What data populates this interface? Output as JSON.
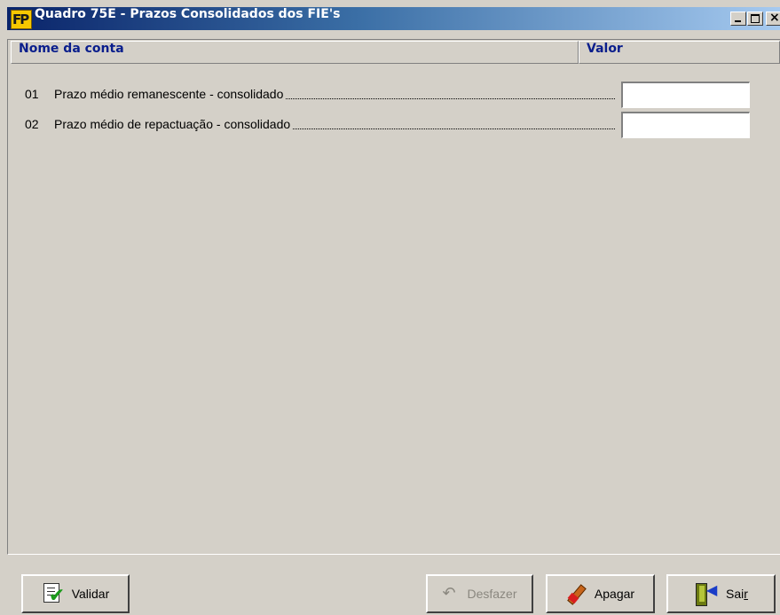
{
  "window": {
    "title": "Quadro 75E - Prazos Consolidados dos FIE's",
    "icon": "fp-app-icon",
    "controls": {
      "minimize": "minimize-icon",
      "maximize": "maximize-icon",
      "close": "close-icon"
    }
  },
  "table": {
    "headers": {
      "name": "Nome da conta",
      "value": "Valor"
    },
    "rows": [
      {
        "number": "01",
        "label": "Prazo médio remanescente - consolidado",
        "value": ""
      },
      {
        "number": "02",
        "label": "Prazo médio de repactuação - consolidado",
        "value": ""
      }
    ]
  },
  "buttons": {
    "validar": {
      "label": "Validar",
      "icon": "validate-sheet-check-icon",
      "enabled": true
    },
    "desfazer": {
      "label": "Desfazer",
      "icon": "undo-arrow-icon",
      "enabled": false
    },
    "apagar": {
      "label": "Apagar",
      "icon": "eraser-brush-icon",
      "enabled": true
    },
    "sair": {
      "label_main": "Sai",
      "label_underlined": "r",
      "icon": "exit-door-icon",
      "enabled": true
    }
  },
  "colors": {
    "face": "#d4d0c8",
    "title_gradient_start": "#0a246a",
    "title_gradient_end": "#a6caf0",
    "header_text": "#0a1e8c"
  }
}
